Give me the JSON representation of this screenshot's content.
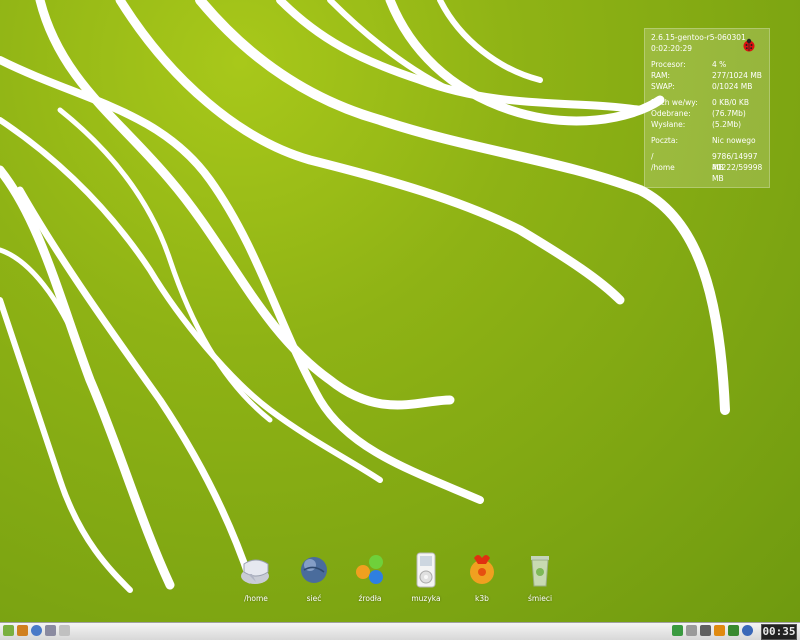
{
  "desktop": {
    "background_color": "#8fb315",
    "swirl_color": "#ffffff"
  },
  "sysmon": {
    "kernel": "2.6.15-gentoo-r5-060301",
    "uptime": "0:02:20:29",
    "rows": [
      {
        "label": "Procesor:",
        "value": "4 %"
      },
      {
        "label": "RAM:",
        "value": "277/1024 MB"
      },
      {
        "label": "SWAP:",
        "value": "0/1024 MB"
      },
      {
        "label": "Ruch we/wy:",
        "value": "0 KB/0 KB"
      },
      {
        "label": "Odebrane:",
        "value": "(76.7Mb)"
      },
      {
        "label": "Wysłane:",
        "value": "(5.2Mb)"
      },
      {
        "label": "Poczta:",
        "value": "Nic nowego"
      },
      {
        "label": "/",
        "value": "9786/14997 MB"
      },
      {
        "label": "/home",
        "value": "40222/59998 MB"
      }
    ]
  },
  "dock": [
    {
      "label": "/home",
      "icon": "home-icon"
    },
    {
      "label": "sieć",
      "icon": "globe-icon"
    },
    {
      "label": "źrodła",
      "icon": "sources-icon"
    },
    {
      "label": "muzyka",
      "icon": "ipod-icon"
    },
    {
      "label": "k3b",
      "icon": "k3b-icon"
    },
    {
      "label": "śmieci",
      "icon": "trash-icon"
    }
  ],
  "taskbar": {
    "clock": "00:35"
  }
}
